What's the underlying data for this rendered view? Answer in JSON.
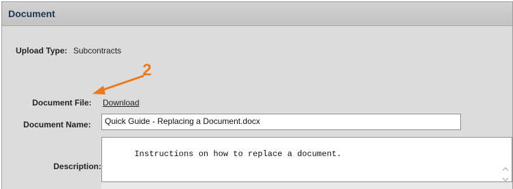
{
  "panel": {
    "title": "Document"
  },
  "upload_type": {
    "label": "Upload Type:",
    "value": "Subcontracts"
  },
  "annotation": {
    "number": "2",
    "color": "#ea7a20"
  },
  "document_file": {
    "label": "Document File:",
    "link_text": "Download"
  },
  "document_name": {
    "label": "Document Name:",
    "value": "Quick Guide - Replacing a Document.docx"
  },
  "description": {
    "label": "Description:",
    "value": "Instructions on how to replace a document."
  }
}
